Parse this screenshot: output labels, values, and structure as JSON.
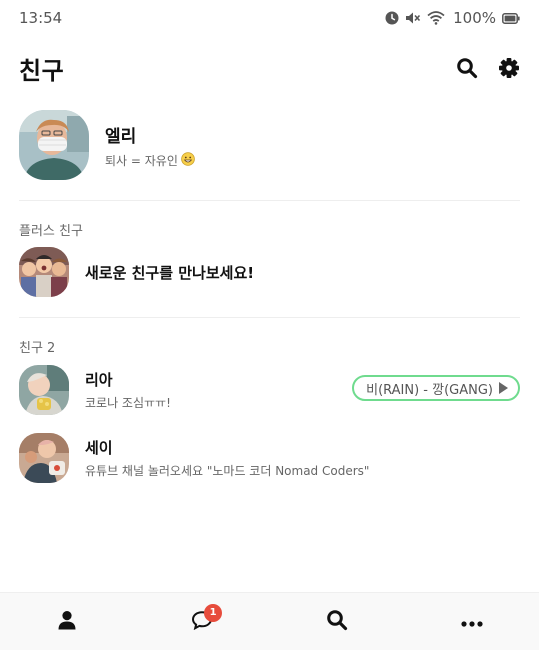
{
  "status_bar": {
    "time": "13:54",
    "battery": "100%",
    "icons": [
      "alarm-icon",
      "mute-icon",
      "wifi-icon",
      "battery-icon"
    ]
  },
  "header": {
    "title": "친구",
    "actions": [
      "search-icon",
      "settings-gear-icon"
    ]
  },
  "my_profile": {
    "name": "엘리",
    "status": "퇴사 = 자유인"
  },
  "plus_friends": {
    "section_label": "플러스 친구",
    "title": "새로운 친구를 만나보세요!"
  },
  "friends": {
    "section_label": "친구 2",
    "items": [
      {
        "name": "리아",
        "status": "코로나 조심ㅠㅠ!",
        "music": "비(RAIN) - 깡(GANG)"
      },
      {
        "name": "세이",
        "status": "유튜브 채널 놀러오세요 \"노마드 코더 Nomad Coders\""
      }
    ]
  },
  "tab_bar": {
    "tabs": [
      "person-icon",
      "chat-bubble-icon",
      "search-icon",
      "more-dots-icon"
    ],
    "chat_badge": "1"
  },
  "colors": {
    "accent_green": "#6fdb8e",
    "badge_red": "#e74c3c"
  }
}
